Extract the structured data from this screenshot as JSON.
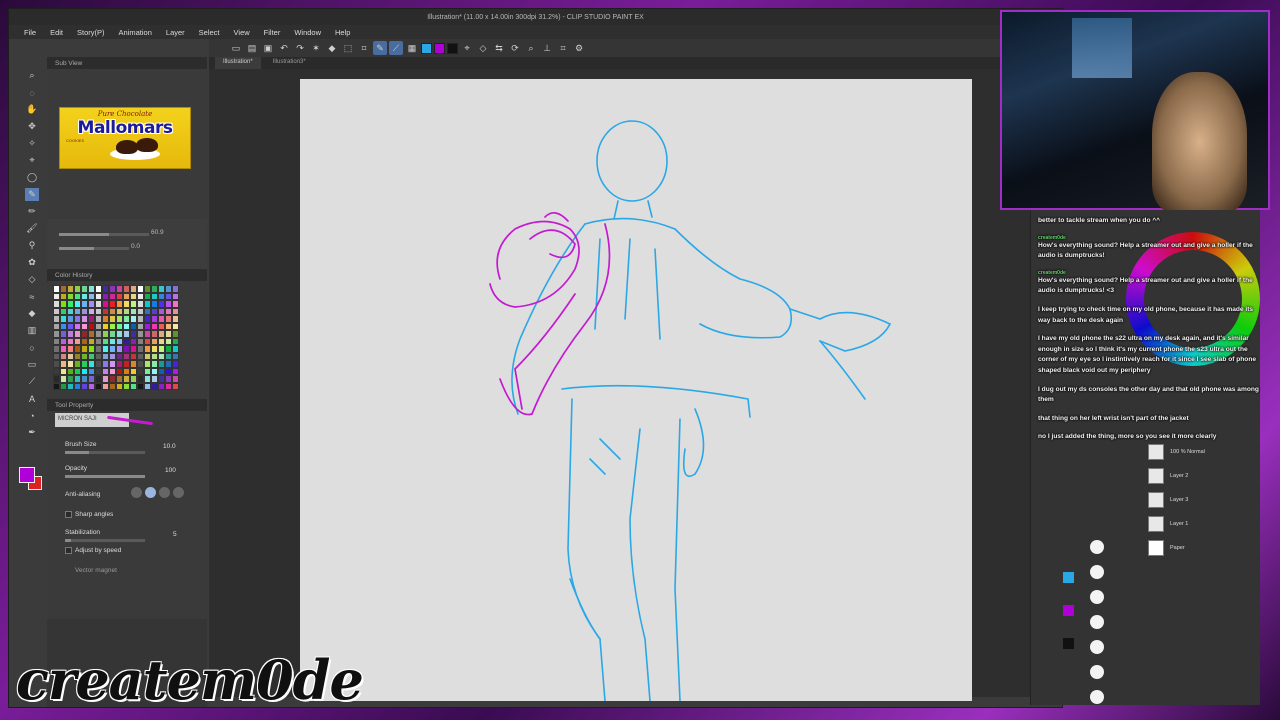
{
  "window": {
    "title": "Illustration* (11.00 x 14.00in 300dpi 31.2%) - CLIP STUDIO PAINT EX"
  },
  "menu": [
    "File",
    "Edit",
    "Story(P)",
    "Animation",
    "Layer",
    "Select",
    "View",
    "Filter",
    "Window",
    "Help"
  ],
  "doc_tabs": [
    "Illustration*",
    "Illustration3*"
  ],
  "sub_view": {
    "tab_label": "Sub View",
    "image": {
      "top_text": "Pure Chocolate",
      "brand": "Mallomars",
      "bottom_text": "COOKIES"
    }
  },
  "navigator": {
    "zoom": "60.9",
    "angle": "0.0"
  },
  "color_history": {
    "tab_label": "Color History"
  },
  "tool_property": {
    "tab_label": "Tool Property",
    "preset_name": "MICRON SAJI",
    "brush_size_label": "Brush Size",
    "brush_size_value": "10.0",
    "opacity_label": "Opacity",
    "opacity_value": "100",
    "antialiasing_label": "Anti-aliasing",
    "sharp_angles_label": "Sharp angles",
    "stabilization_label": "Stabilization",
    "stabilization_value": "5",
    "adjust_by_speed_label": "Adjust by speed",
    "vector_magnet_label": "Vector magnet"
  },
  "colors": {
    "foreground": "#b000d8",
    "background": "#e02020",
    "sketch_blue": "#2aa8e6",
    "sketch_magenta": "#c41ad0"
  },
  "chat": [
    {
      "user": "",
      "text": "better to tackle stream when you do ^^"
    },
    {
      "user": "createm0de",
      "text": "How's everything sound? Help a streamer out and give a holler if the audio is dumptrucks!"
    },
    {
      "user": "createm0de",
      "text": "How's everything sound? Help a streamer out and give a holler if the audio is dumptrucks! <3"
    },
    {
      "user": "",
      "text": "I keep trying to check time on my old phone, because it has made its way back to the desk again"
    },
    {
      "user": "",
      "text": "I have my old phone the s22 ultra on my desk again, and it's similar enough in size so I think it's my current phone the s23 ultra out the corner of my eye so I instintively reach for it since I see slab of phone shaped black void out my periphery"
    },
    {
      "user": "",
      "text": "I dug out my ds consoles the other day and that old phone was among them"
    },
    {
      "user": "",
      "text": "that thing on her left wrist isn't part of the jacket"
    },
    {
      "user": "",
      "text": "no I just added the thing, more so you see it more clearly"
    }
  ],
  "layers": [
    {
      "name": "100 % Normal"
    },
    {
      "name": "Layer 2"
    },
    {
      "name": "Layer 3"
    },
    {
      "name": "Layer 1"
    },
    {
      "name": "Paper"
    }
  ],
  "watermark": "createm0de"
}
